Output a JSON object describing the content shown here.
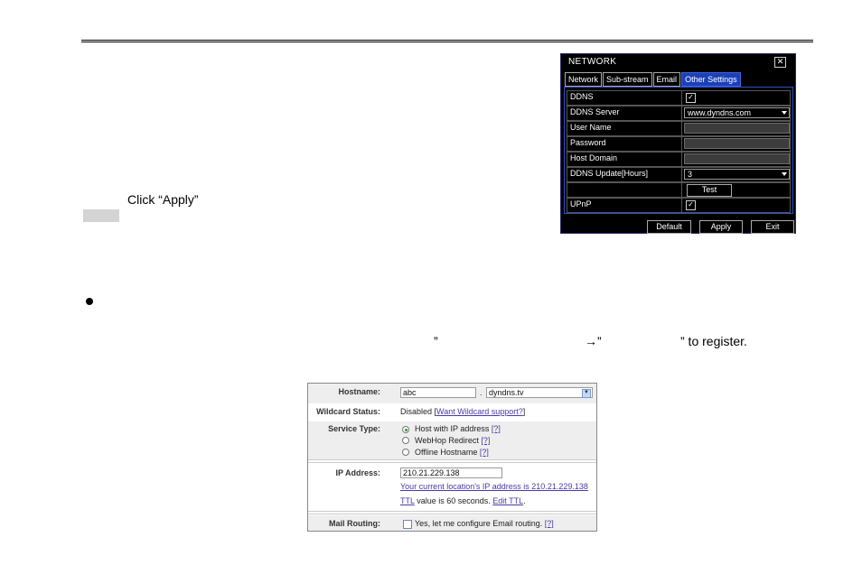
{
  "document": {
    "click_apply": "Click “Apply”",
    "register_q1": "”",
    "register_q2": "”",
    "register_arrow": "→”",
    "register_tail": "” to register."
  },
  "network_dialog": {
    "title": "NETWORK",
    "close_glyph": "✕",
    "tabs": [
      {
        "label": "Network"
      },
      {
        "label": "Sub-stream"
      },
      {
        "label": "Email"
      },
      {
        "label": "Other Settings",
        "active": true
      }
    ],
    "rows": {
      "ddns": {
        "label": "DDNS",
        "checked": "✓"
      },
      "ddns_server": {
        "label": "DDNS Server",
        "value": "www.dyndns.com"
      },
      "user_name": {
        "label": "User Name",
        "value": ""
      },
      "password": {
        "label": "Password",
        "value": ""
      },
      "host_domain": {
        "label": "Host Domain",
        "value": ""
      },
      "ddns_update": {
        "label": "DDNS Update[Hours]",
        "value": "3"
      },
      "test_button": "Test",
      "upnp": {
        "label": "UPnP",
        "checked": "✓"
      }
    },
    "buttons": {
      "default": "Default",
      "apply": "Apply",
      "exit": "Exit"
    },
    "colors": {
      "background": "#000000",
      "active_tab": "#1c40b8",
      "panel_border": "#2d52c8"
    }
  },
  "dyndns_form": {
    "hostname_label": "Hostname:",
    "hostname_value": "abc",
    "dot": ".",
    "domain_value": "dyndns.tv",
    "wildcard_label": "Wildcard Status:",
    "wildcard_text": "Disabled [",
    "wildcard_link": "Want Wildcard support?",
    "wildcard_close": "]",
    "service_label": "Service Type:",
    "service_options": [
      {
        "label": "Host with IP address",
        "help": "[?]",
        "selected": true
      },
      {
        "label": "WebHop Redirect",
        "help": "[?]",
        "selected": false
      },
      {
        "label": "Offline Hostname",
        "help": "[?]",
        "selected": false
      }
    ],
    "ip_label": "IP Address:",
    "ip_value": "210.21.229.138",
    "location_link": "Your current location's IP address is 210.21.229.138",
    "ttl_link": "TTL",
    "ttl_text": "value is 60 seconds.",
    "edit_ttl": "Edit TTL",
    "edit_ttl_end": ".",
    "mail_label": "Mail Routing:",
    "mail_text": "Yes, let me configure Email routing.",
    "mail_help": "[?]"
  }
}
